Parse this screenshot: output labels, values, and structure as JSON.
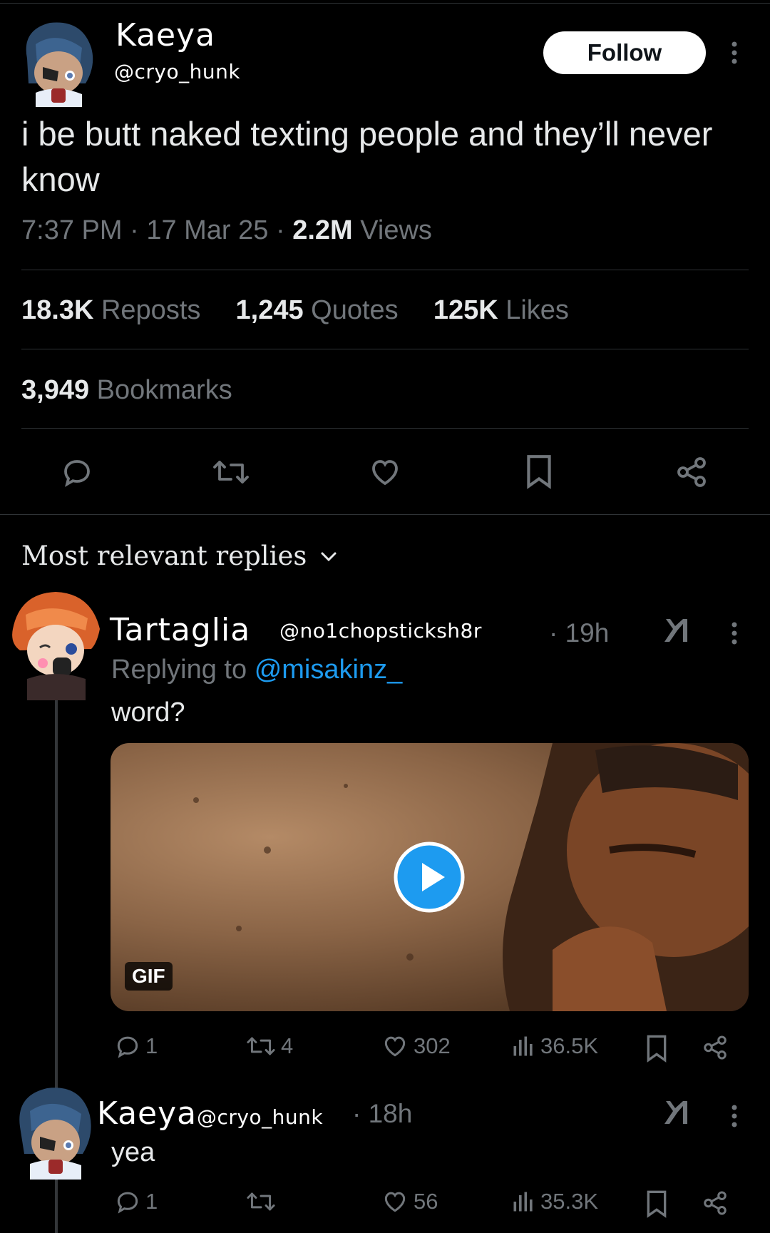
{
  "tweet": {
    "author_name": "Kaeya",
    "author_handle": "@cryo_hunk",
    "follow_label": "Follow",
    "text": "i be butt naked texting people and they’ll never know",
    "time": "7:37 PM",
    "date": "17 Mar 25",
    "views_count": "2.2M",
    "views_label": "Views",
    "reposts_count": "18.3K",
    "reposts_label": "Reposts",
    "quotes_count": "1,245",
    "quotes_label": "Quotes",
    "likes_count": "125K",
    "likes_label": "Likes",
    "bookmarks_count": "3,949",
    "bookmarks_label": "Bookmarks"
  },
  "replies_header": "Most relevant replies",
  "replies": [
    {
      "name": "Tartaglia",
      "handle": "@no1chopsticksh8r",
      "time": "· 19h",
      "replying_prefix": "Replying to",
      "replying_to": "@misakinz_",
      "text": "word?",
      "media_badge": "GIF",
      "comments": "1",
      "reposts": "4",
      "likes": "302",
      "views": "36.5K"
    },
    {
      "name": "Kaeya",
      "handle": "@cryo_hunk",
      "time": "· 18h",
      "text": "yea",
      "comments": "1",
      "reposts": "",
      "likes": "56",
      "views": "35.3K"
    }
  ],
  "colors": {
    "background": "#000000",
    "text": "#e7e9ea",
    "muted": "#71767b",
    "link": "#1d9bf0",
    "divider": "#2f3336",
    "play": "#1d9bf0"
  }
}
